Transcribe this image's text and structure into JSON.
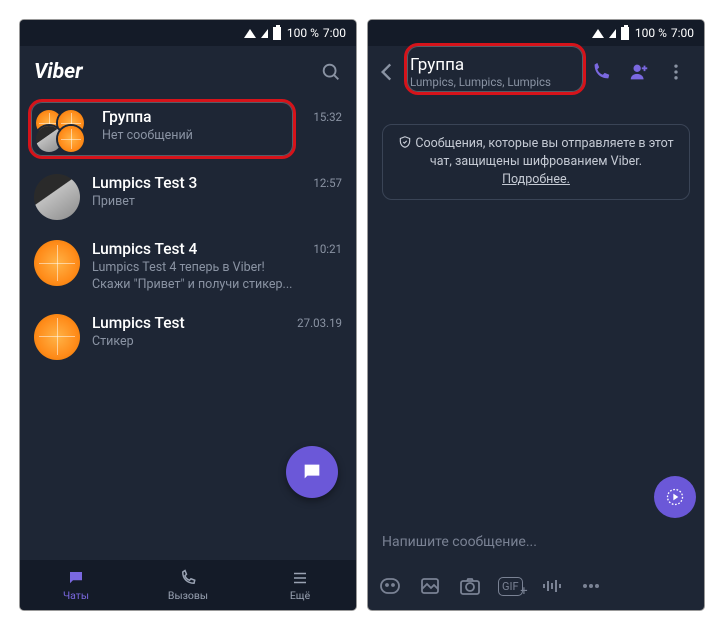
{
  "statusbar": {
    "battery": "100 %",
    "time": "7:00"
  },
  "left": {
    "brand": "Viber",
    "chats": [
      {
        "title": "Группа",
        "subtitle": "Нет сообщений",
        "time": "15:32"
      },
      {
        "title": "Lumpics Test 3",
        "subtitle": "Привет",
        "time": "12:57"
      },
      {
        "title": "Lumpics Test 4",
        "subtitle": "Lumpics Test 4 теперь в Viber! Скажи \"Привет\" и получи стикер...",
        "time": "10:21"
      },
      {
        "title": "Lumpics Test",
        "subtitle": "Стикер",
        "time": "27.03.19"
      }
    ],
    "nav": {
      "chats": "Чаты",
      "calls": "Вызовы",
      "more": "Ещё"
    }
  },
  "right": {
    "header": {
      "title": "Группа",
      "subtitle": "Lumpics, Lumpics, Lumpics"
    },
    "encryption_prefix": "Сообщения, которые вы отправляете в этот чат, защищены шифрованием Viber. ",
    "encryption_link": "Подробнее.",
    "input_placeholder": "Напишите сообщение..."
  }
}
